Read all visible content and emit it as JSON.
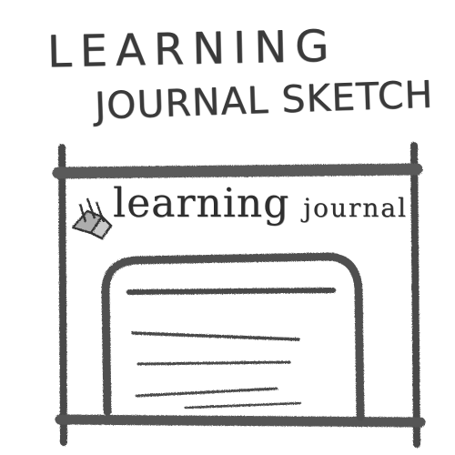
{
  "sketch_title": {
    "line1": "LEARNING",
    "line2": "JOURNAL SKETCH"
  },
  "window": {
    "app_title_main": "learning",
    "app_title_sub": "journal"
  },
  "icons": {
    "logo": "book-icon"
  },
  "colors": {
    "ink": "#3a3a3a",
    "pencil": "#555555",
    "paper": "#ffffff"
  }
}
